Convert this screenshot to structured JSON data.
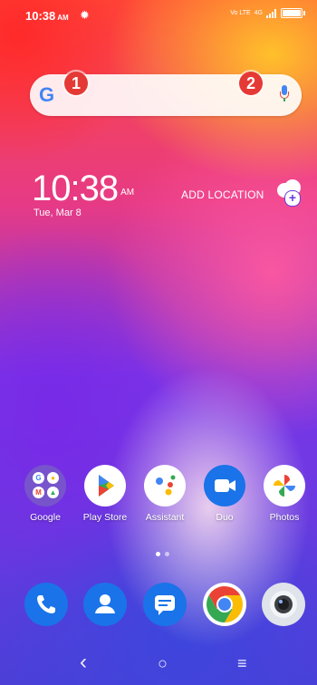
{
  "status_bar": {
    "time": "10:38",
    "ampm": "AM",
    "indicators": [
      "gear-icon",
      "volte-icon",
      "signal-icon",
      "battery-icon"
    ],
    "volte": "Vo LTE",
    "network": "4G",
    "battery_level": 0.9
  },
  "search_widget": {
    "logo": "G",
    "badges": [
      "1",
      "2"
    ]
  },
  "clock_widget": {
    "time": "10:38",
    "ampm": "AM",
    "date": "Tue, Mar 8",
    "add_location": "ADD LOCATION"
  },
  "apps": [
    {
      "label": "Google",
      "icon": "google-folder-icon"
    },
    {
      "label": "Play Store",
      "icon": "play-store-icon"
    },
    {
      "label": "Assistant",
      "icon": "assistant-icon"
    },
    {
      "label": "Duo",
      "icon": "duo-icon"
    },
    {
      "label": "Photos",
      "icon": "photos-icon"
    }
  ],
  "page_indicator": {
    "pages": 2,
    "current": 1
  },
  "dock": [
    {
      "icon": "phone-icon"
    },
    {
      "icon": "contacts-icon"
    },
    {
      "icon": "messages-icon"
    },
    {
      "icon": "chrome-icon"
    },
    {
      "icon": "camera-icon"
    }
  ],
  "nav_bar": {
    "back": "‹",
    "home": "○",
    "menu": "≡"
  },
  "colors": {
    "badge": "#e53935",
    "google_blue": "#4285f4",
    "google_red": "#ea4335",
    "google_yellow": "#fbbc05",
    "google_green": "#34a853",
    "duo": "#1a73e8"
  }
}
